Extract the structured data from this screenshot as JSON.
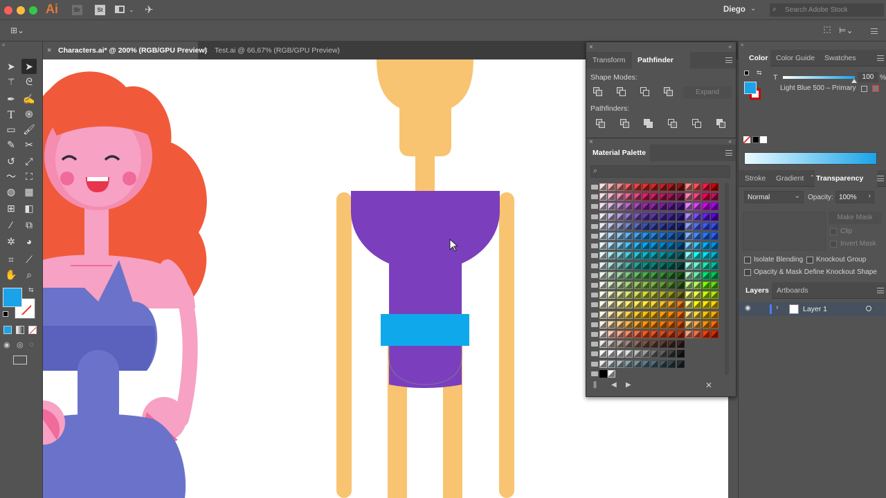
{
  "app": {
    "logo": "Ai",
    "bridge": "Br",
    "stock": "St",
    "user": "Diego",
    "search_placeholder": "Search Adobe Stock"
  },
  "documents": {
    "tabs": [
      {
        "label": "Characters.ai* @ 200% (RGB/GPU Preview)",
        "active": true
      },
      {
        "label": "Test.ai @ 66,67% (RGB/GPU Preview)",
        "active": false
      }
    ]
  },
  "tools": {
    "fill_color": "#1aa3e8",
    "icons": [
      "selection-icon",
      "direct-selection-icon",
      "magic-wand-icon",
      "lasso-icon",
      "pen-icon",
      "curvature-icon",
      "type-icon",
      "spiral-icon",
      "rectangle-icon",
      "paintbrush-icon",
      "shaper-icon",
      "eraser-icon",
      "rotate-icon",
      "scale-icon",
      "warp-icon",
      "free-transform-icon",
      "shape-builder-icon",
      "perspective-grid-icon",
      "mesh-icon",
      "gradient-icon",
      "eyedropper-icon",
      "blend-icon",
      "symbol-sprayer-icon",
      "column-graph-icon",
      "artboard-icon",
      "slice-icon",
      "hand-icon",
      "zoom-icon"
    ]
  },
  "pathfinder_panel": {
    "tabs": [
      "Transform",
      "Pathfinder"
    ],
    "active_tab": "Pathfinder",
    "shape_modes_label": "Shape Modes:",
    "expand_label": "Expand",
    "pathfinders_label": "Pathfinders:"
  },
  "material_palette": {
    "title": "Material Palette",
    "rows": [
      [
        "#fde0e0",
        "#f9b4b4",
        "#f48a8a",
        "#ef5f5f",
        "#ec4545",
        "#e82f2f",
        "#d82828",
        "#c42222",
        "#b01b1b",
        "#931414",
        "#ff8a80",
        "#ff5252",
        "#ff1744",
        "#d50000"
      ],
      [
        "#fce0ec",
        "#f8b9d2",
        "#f48fb4",
        "#f06496",
        "#ec4584",
        "#e91e63",
        "#d81b60",
        "#c2185b",
        "#ad1457",
        "#880e4f",
        "#ff80ab",
        "#ff4081",
        "#f50057",
        "#c51162"
      ],
      [
        "#f3e0f5",
        "#e1bee7",
        "#ce93d8",
        "#ba68c8",
        "#ab47bc",
        "#9c27b0",
        "#8e24aa",
        "#7b1fa2",
        "#6a1b9a",
        "#4a148c",
        "#ea80fc",
        "#e040fb",
        "#d500f9",
        "#aa00ff"
      ],
      [
        "#ede7f6",
        "#d1c4e9",
        "#b39ddb",
        "#9575cd",
        "#7e57c2",
        "#673ab7",
        "#5e35b1",
        "#512da8",
        "#4527a0",
        "#311b92",
        "#b388ff",
        "#7c4dff",
        "#651fff",
        "#6200ea"
      ],
      [
        "#e8eaf6",
        "#c5cae9",
        "#9fa8da",
        "#7986cb",
        "#5c6bc0",
        "#3f51b5",
        "#3949ab",
        "#303f9f",
        "#283593",
        "#1a237e",
        "#8c9eff",
        "#536dfe",
        "#3d5afe",
        "#304ffe"
      ],
      [
        "#e3f2fd",
        "#bbdefb",
        "#90caf9",
        "#64b5f6",
        "#42a5f5",
        "#2196f3",
        "#1e88e5",
        "#1976d2",
        "#1565c0",
        "#0d47a1",
        "#82b1ff",
        "#448aff",
        "#2979ff",
        "#2962ff"
      ],
      [
        "#e1f5fe",
        "#b3e5fc",
        "#81d4fa",
        "#4fc3f7",
        "#29b6f6",
        "#03a9f4",
        "#039be5",
        "#0288d1",
        "#0277bd",
        "#01579b",
        "#80d8ff",
        "#40c4ff",
        "#00b0ff",
        "#0091ea"
      ],
      [
        "#e0f7fa",
        "#b2ebf2",
        "#80deea",
        "#4dd0e1",
        "#26c6da",
        "#00bcd4",
        "#00acc1",
        "#0097a7",
        "#00838f",
        "#006064",
        "#84ffff",
        "#18ffff",
        "#00e5ff",
        "#00b8d4"
      ],
      [
        "#e0f2f1",
        "#b2dfdb",
        "#80cbc4",
        "#4db6ac",
        "#26a69a",
        "#009688",
        "#00897b",
        "#00796b",
        "#00695c",
        "#004d40",
        "#a7ffeb",
        "#64ffda",
        "#1de9b6",
        "#00bfa5"
      ],
      [
        "#e8f5e9",
        "#c8e6c9",
        "#a5d6a7",
        "#81c784",
        "#66bb6a",
        "#4caf50",
        "#43a047",
        "#388e3c",
        "#2e7d32",
        "#1b5e20",
        "#b9f6ca",
        "#69f0ae",
        "#00e676",
        "#00c853"
      ],
      [
        "#f1f8e9",
        "#dcedc8",
        "#c5e1a5",
        "#aed581",
        "#9ccc65",
        "#8bc34a",
        "#7cb342",
        "#689f38",
        "#558b2f",
        "#33691e",
        "#ccff90",
        "#b2ff59",
        "#76ff03",
        "#64dd17"
      ],
      [
        "#f9fbe7",
        "#f0f4c3",
        "#e6ee9c",
        "#dce775",
        "#d4e157",
        "#cddc39",
        "#c0ca33",
        "#afb42b",
        "#9e9d24",
        "#827717",
        "#f4ff81",
        "#eeff41",
        "#c6ff00",
        "#aeea00"
      ],
      [
        "#fffde7",
        "#fff9c4",
        "#fff59d",
        "#fff176",
        "#ffee58",
        "#ffeb3b",
        "#fdd835",
        "#fbc02d",
        "#f9a825",
        "#f57f17",
        "#ffff8d",
        "#ffff00",
        "#ffea00",
        "#ffd600"
      ],
      [
        "#fff8e1",
        "#ffecb3",
        "#ffe082",
        "#ffd54f",
        "#ffca28",
        "#ffc107",
        "#ffb300",
        "#ffa000",
        "#ff8f00",
        "#ff6f00",
        "#ffe57f",
        "#ffd740",
        "#ffc400",
        "#ffab00"
      ],
      [
        "#fff3e0",
        "#ffe0b2",
        "#ffcc80",
        "#ffb74d",
        "#ffa726",
        "#ff9800",
        "#fb8c00",
        "#f57c00",
        "#ef6c00",
        "#e65100",
        "#ffd180",
        "#ffab40",
        "#ff9100",
        "#ff6d00"
      ],
      [
        "#fbe9e7",
        "#ffccbc",
        "#ffab91",
        "#ff8a65",
        "#ff7043",
        "#ff5722",
        "#f4511e",
        "#e64a19",
        "#d84315",
        "#bf360c",
        "#ff9e80",
        "#ff6e40",
        "#ff3d00",
        "#dd2c00"
      ],
      [
        "#efebe9",
        "#d7ccc8",
        "#bcaaa4",
        "#a1887f",
        "#8d6e63",
        "#795548",
        "#6d4c41",
        "#5d4037",
        "#4e342e",
        "#3e2723"
      ],
      [
        "#fafafa",
        "#f5f5f5",
        "#eeeeee",
        "#e0e0e0",
        "#bdbdbd",
        "#9e9e9e",
        "#757575",
        "#616161",
        "#424242",
        "#212121"
      ],
      [
        "#eceff1",
        "#cfd8dc",
        "#b0bec5",
        "#90a4ae",
        "#78909c",
        "#607d8b",
        "#546e7a",
        "#455a64",
        "#37474f",
        "#263238"
      ],
      [
        "#000000",
        "#ffffff"
      ]
    ]
  },
  "color_panel": {
    "tabs": [
      "Color",
      "Color Guide",
      "Swatches"
    ],
    "active_tab": "Color",
    "tint_label": "T",
    "tint_value": "100",
    "percent": "%",
    "swatch_name": "Light Blue 500 – Primary",
    "fill": "#1aa3e8"
  },
  "transparency_panel": {
    "tabs": [
      "Stroke",
      "Gradient",
      "Transparency"
    ],
    "active_tab": "Transparency",
    "blend_mode": "Normal",
    "opacity_label": "Opacity:",
    "opacity_value": "100%",
    "make_mask": "Make Mask",
    "clip": "Clip",
    "invert_mask": "Invert Mask",
    "isolate_blending": "Isolate Blending",
    "knockout_group": "Knockout Group",
    "opacity_mask": "Opacity & Mask Define Knockout Shape"
  },
  "layers_panel": {
    "tabs": [
      "Layers",
      "Artboards"
    ],
    "active_tab": "Layers",
    "layers": [
      {
        "name": "Layer 1"
      }
    ]
  }
}
